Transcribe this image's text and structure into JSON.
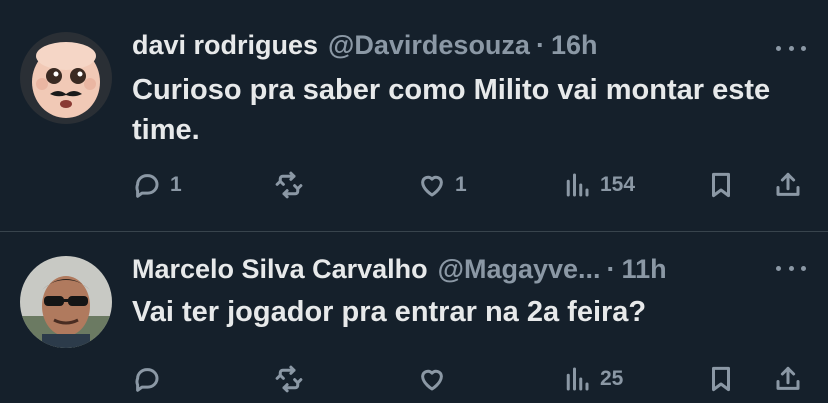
{
  "tweets": [
    {
      "author_name": "davi rodrigues",
      "handle": "@Davirdesouza",
      "separator": "·",
      "time": "16h",
      "text": "Curioso pra saber como Milito vai montar este time.",
      "counts": {
        "replies": "1",
        "retweets": "",
        "likes": "1",
        "views": "154"
      },
      "icons": {
        "avatar": "baby-face-avatar",
        "reply": "reply-icon",
        "retweet": "retweet-icon",
        "like": "heart-icon",
        "views": "views-bar-chart-icon",
        "bookmark": "bookmark-icon",
        "share": "share-icon",
        "more": "more-options-icon"
      }
    },
    {
      "author_name": "Marcelo Silva Carvalho",
      "handle": "@Magayve...",
      "separator": "·",
      "time": "11h",
      "text": "Vai ter jogador pra entrar na 2a feira?",
      "counts": {
        "replies": "",
        "retweets": "",
        "likes": "",
        "views": "25"
      },
      "icons": {
        "avatar": "man-sunglasses-avatar",
        "reply": "reply-icon",
        "retweet": "retweet-icon",
        "like": "heart-icon",
        "views": "views-bar-chart-icon",
        "bookmark": "bookmark-icon",
        "share": "share-icon",
        "more": "more-options-icon"
      }
    }
  ],
  "colors": {
    "background": "#15202b",
    "text": "#e7e9ea",
    "muted": "#8b98a5",
    "divider": "#38444d"
  }
}
